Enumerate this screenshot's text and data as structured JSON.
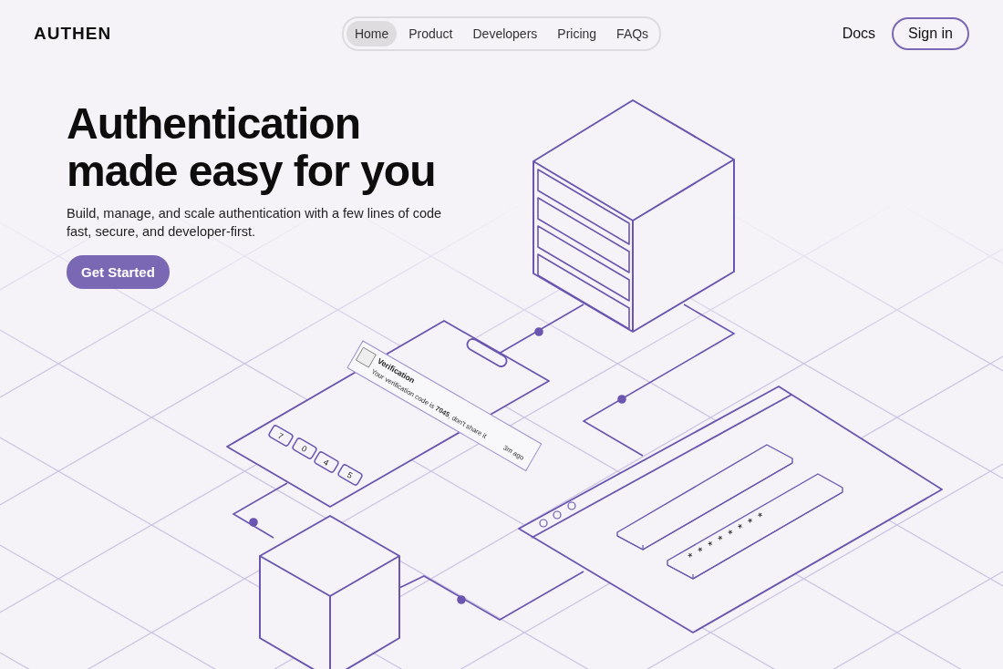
{
  "brand": {
    "logo": "AUTHEN"
  },
  "nav": [
    {
      "label": "Home",
      "selected": true
    },
    {
      "label": "Product",
      "selected": false
    },
    {
      "label": "Developers",
      "selected": false
    },
    {
      "label": "Pricing",
      "selected": false
    },
    {
      "label": "FAQs",
      "selected": false
    }
  ],
  "docs_link": "Docs",
  "sign_in": "Sign in",
  "hero": {
    "title_lines": [
      "Authentication",
      "made easy for you"
    ],
    "subtitle_lines": [
      "Build, manage, and scale authentication with a few lines of code",
      "fast, secure, and developer-first."
    ],
    "cta": "Get Started"
  },
  "illustration": {
    "notification": {
      "title": "Verification",
      "body": "Your verification code is **7045**, don't share it",
      "time": "3m ago"
    },
    "code_digits": [
      "7",
      "0",
      "4",
      "5"
    ],
    "password_mask": "* * * * * * * *"
  }
}
